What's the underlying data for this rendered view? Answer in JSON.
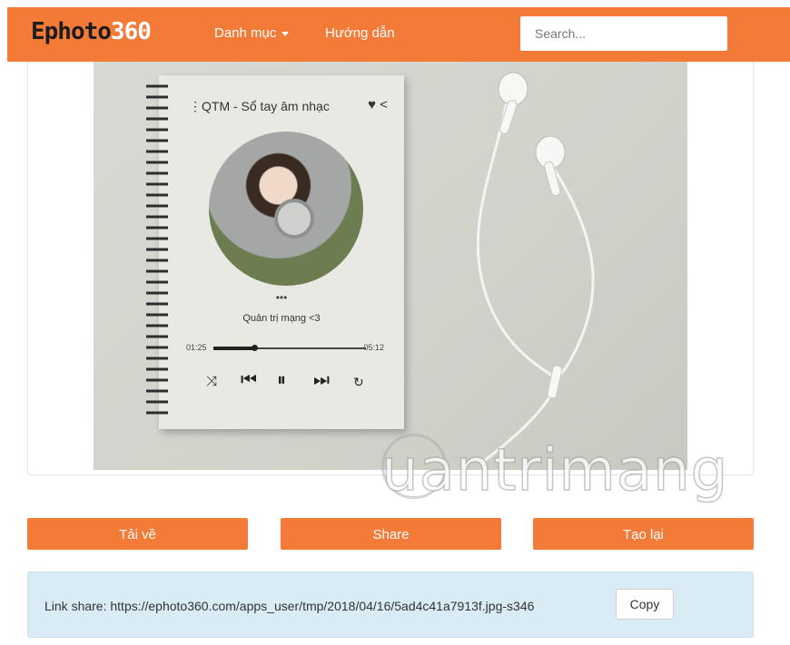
{
  "navbar": {
    "logo_text": "Ephoto",
    "logo_number": "360",
    "menu": [
      {
        "label": "Danh mục"
      },
      {
        "label": "Hướng dẫn"
      }
    ],
    "search_placeholder": "Search..."
  },
  "preview": {
    "player_title": "QTM - Sổ tay âm nhạc",
    "player_more": "•••",
    "artist": "Quản trị mạng <3",
    "time_elapsed": "01:25",
    "time_total": "05:12",
    "progress_fraction": 0.27
  },
  "watermark": "uantrimang",
  "actions": {
    "download_label": "Tải về",
    "share_label": "Share",
    "recreate_label": "Tạo lại"
  },
  "share_box": {
    "prefix": "Link share:",
    "url": "https://ephoto360.com/apps_user/tmp/2018/04/16/5ad4c41a7913f.jpg-s346",
    "copy_label": "Copy"
  },
  "colors": {
    "accent": "#f47a38",
    "info_bg": "#d9ecf5"
  }
}
